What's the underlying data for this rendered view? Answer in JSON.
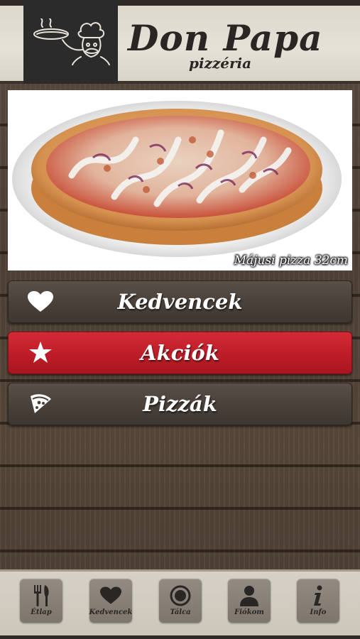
{
  "app": {
    "brand_name": "Don Papa",
    "brand_sub": "pizzéria",
    "logo_icon": "chef-logo-icon"
  },
  "hero": {
    "caption": "Májusi pizza 32cm",
    "image": "pizza-photo"
  },
  "menu": {
    "items": [
      {
        "label": "Kedvencek",
        "icon": "heart-icon",
        "style": "dark"
      },
      {
        "label": "Akciók",
        "icon": "star-icon",
        "style": "red"
      },
      {
        "label": "Pizzák",
        "icon": "pizza-slice-icon",
        "style": "dark"
      }
    ]
  },
  "tabbar": {
    "tabs": [
      {
        "label": "Étlap",
        "icon": "fork-knife-icon"
      },
      {
        "label": "Kedvencek",
        "icon": "heart-icon"
      },
      {
        "label": "Tálca",
        "icon": "tray-icon"
      },
      {
        "label": "Fiókom",
        "icon": "user-icon"
      },
      {
        "label": "Info",
        "icon": "info-icon"
      }
    ]
  },
  "colors": {
    "accent_red": "#bf1e29",
    "dark_button": "#4a413b",
    "header_bg": "#e5e1d7",
    "logo_bg": "#2b2b2b"
  }
}
